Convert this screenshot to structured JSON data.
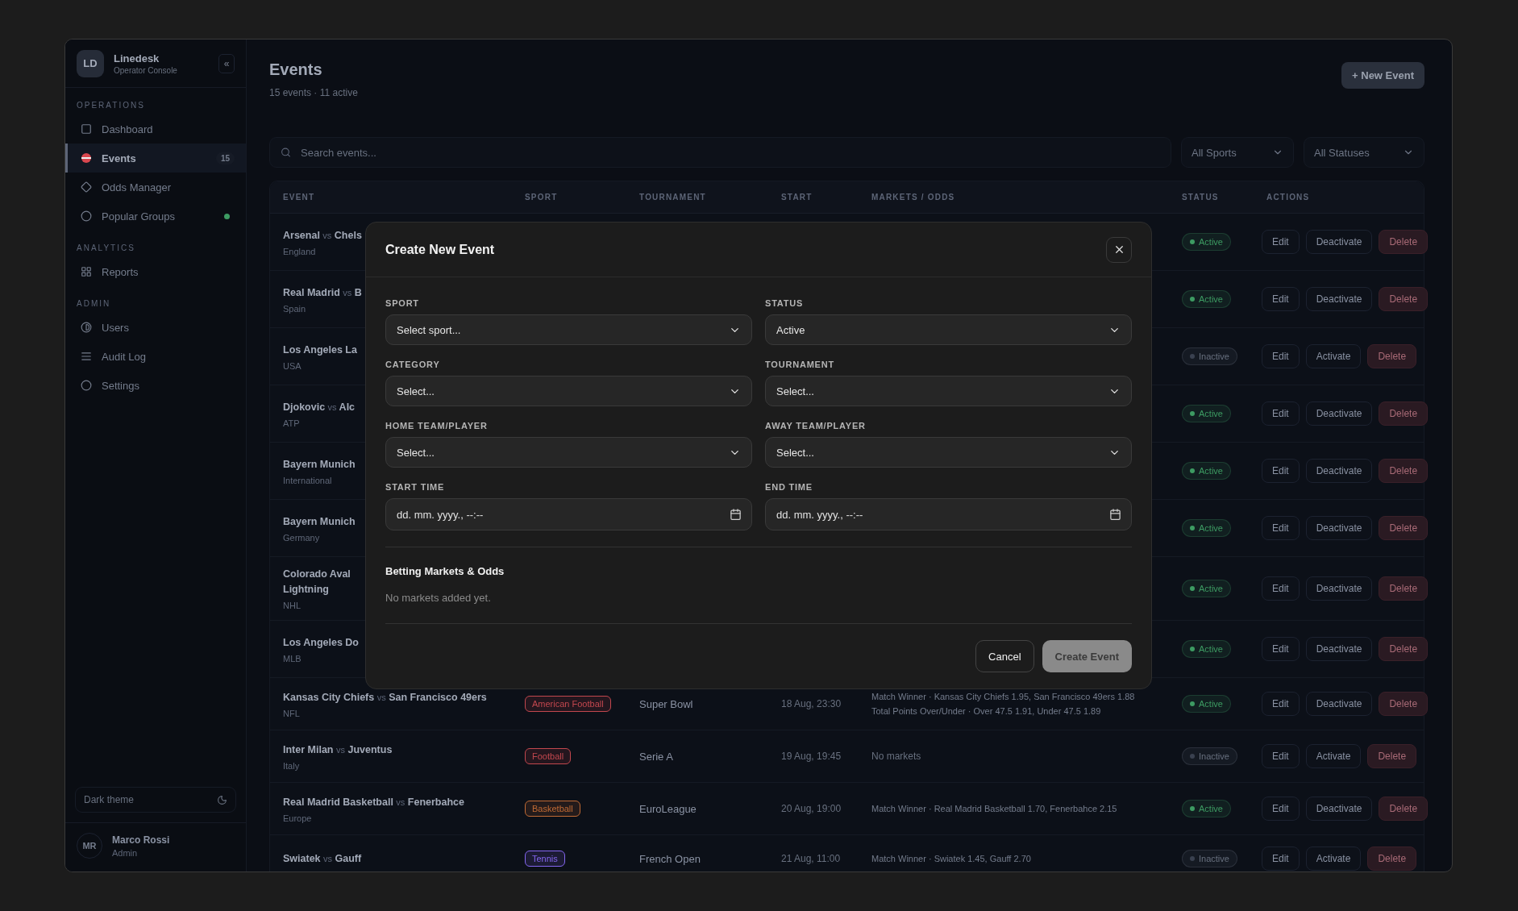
{
  "sidebar": {
    "brand": {
      "initials": "LD",
      "name": "Linedesk",
      "subtitle": "Operator Console",
      "collapse": "«"
    },
    "sections": [
      {
        "title": "OPERATIONS",
        "items": [
          {
            "label": "Dashboard",
            "selected": false,
            "dot": false
          },
          {
            "label": "Events",
            "selected": true,
            "badge": "15",
            "dot": false
          },
          {
            "label": "Odds Manager",
            "selected": false,
            "dot": false
          },
          {
            "label": "Popular Groups",
            "selected": false,
            "dot": true
          }
        ]
      },
      {
        "title": "ANALYTICS",
        "items": [
          {
            "label": "Reports",
            "selected": false,
            "dot": false
          }
        ]
      },
      {
        "title": "ADMIN",
        "items": [
          {
            "label": "Users",
            "selected": false,
            "dot": false
          },
          {
            "label": "Audit Log",
            "selected": false,
            "dot": false
          },
          {
            "label": "Settings",
            "selected": false,
            "dot": false
          }
        ]
      }
    ],
    "theme_toggle": {
      "label": "Dark theme"
    },
    "user": {
      "initials": "MR",
      "name": "Marco Rossi",
      "role": "Admin"
    }
  },
  "page": {
    "title": "Events",
    "summary": "15 events · 11 active",
    "new_button": "+ New Event"
  },
  "filters": {
    "search": {
      "placeholder": "Search events..."
    },
    "sport": "All Sports",
    "status": "All Statuses"
  },
  "table": {
    "columns": [
      "EVENT",
      "SPORT",
      "TOURNAMENT",
      "START",
      "MARKETS / ODDS",
      "STATUS",
      "ACTIONS"
    ],
    "rows": [
      {
        "home": "Arsenal",
        "vs": "vs",
        "away": "Chels",
        "region": "England",
        "status": "Active",
        "active": true,
        "actions": [
          "Edit",
          "Deactivate",
          "Delete"
        ]
      },
      {
        "home": "Real Madrid",
        "vs": "vs",
        "away": "B",
        "region": "Spain",
        "status": "Active",
        "active": true,
        "actions": [
          "Edit",
          "Deactivate",
          "Delete"
        ]
      },
      {
        "home": "Los Angeles La",
        "region": "USA",
        "status": "Inactive",
        "active": false,
        "actions": [
          "Edit",
          "Activate",
          "Delete"
        ]
      },
      {
        "home": "Djokovic",
        "vs": "vs",
        "away": "Alc",
        "region": "ATP",
        "status": "Active",
        "active": true,
        "actions": [
          "Edit",
          "Deactivate",
          "Delete"
        ]
      },
      {
        "home": "Bayern Munich",
        "region": "International",
        "status": "Active",
        "active": true,
        "actions": [
          "Edit",
          "Deactivate",
          "Delete"
        ]
      },
      {
        "home": "Bayern Munich",
        "region": "Germany",
        "status": "Active",
        "active": true,
        "actions": [
          "Edit",
          "Deactivate",
          "Delete"
        ]
      },
      {
        "home": "Colorado Aval",
        "line2": "Lightning",
        "region": "NHL",
        "status": "Active",
        "active": true,
        "actions": [
          "Edit",
          "Deactivate",
          "Delete"
        ]
      },
      {
        "home": "Los Angeles Do",
        "region": "MLB",
        "status": "Active",
        "active": true,
        "actions": [
          "Edit",
          "Deactivate",
          "Delete"
        ]
      },
      {
        "home": "Kansas City Chiefs",
        "vs": "vs",
        "away": "San Francisco 49ers",
        "region": "NFL",
        "sport": {
          "label": "American Football",
          "color": "#c2474e"
        },
        "tournament": "Super Bowl",
        "start": "18 Aug, 23:30",
        "markets": [
          "Match Winner · Kansas City Chiefs 1.95, San Francisco 49ers 1.88",
          "Total Points Over/Under · Over 47.5 1.91, Under 47.5 1.89"
        ],
        "status": "Active",
        "active": true,
        "actions": [
          "Edit",
          "Deactivate",
          "Delete"
        ]
      },
      {
        "home": "Inter Milan",
        "vs": "vs",
        "away": "Juventus",
        "region": "Italy",
        "sport": {
          "label": "Football",
          "color": "#c2474e"
        },
        "tournament": "Serie A",
        "start": "19 Aug, 19:45",
        "markets_note": "No markets",
        "status": "Inactive",
        "active": false,
        "actions": [
          "Edit",
          "Activate",
          "Delete"
        ]
      },
      {
        "home": "Real Madrid Basketball",
        "vs": "vs",
        "away": "Fenerbahce",
        "region": "Europe",
        "sport": {
          "label": "Basketball",
          "color": "#c06a34"
        },
        "tournament": "EuroLeague",
        "start": "20 Aug, 19:00",
        "markets": [
          "Match Winner · Real Madrid Basketball 1.70, Fenerbahce 2.15"
        ],
        "status": "Active",
        "active": true,
        "actions": [
          "Edit",
          "Deactivate",
          "Delete"
        ]
      },
      {
        "home": "Swiatek",
        "vs": "vs",
        "away": "Gauff",
        "sport": {
          "label": "Tennis",
          "color": "#8466f0"
        },
        "tournament": "French Open",
        "start": "21 Aug, 11:00",
        "markets": [
          "Match Winner · Swiatek 1.45, Gauff 2.70"
        ],
        "status": "Inactive",
        "active": false,
        "actions": [
          "Edit",
          "Activate",
          "Delete"
        ]
      }
    ]
  },
  "modal": {
    "title": "Create New Event",
    "fields": [
      {
        "label": "SPORT",
        "kind": "select",
        "value": "Select sport..."
      },
      {
        "label": "STATUS",
        "kind": "select",
        "value": "Active"
      },
      {
        "label": "CATEGORY",
        "kind": "select",
        "value": "Select..."
      },
      {
        "label": "TOURNAMENT",
        "kind": "select",
        "value": "Select..."
      },
      {
        "label": "HOME TEAM/PLAYER",
        "kind": "select",
        "value": "Select..."
      },
      {
        "label": "AWAY TEAM/PLAYER",
        "kind": "select",
        "value": "Select..."
      },
      {
        "label": "START TIME",
        "kind": "datetime",
        "placeholder": "dd. mm. yyyy., --:--"
      },
      {
        "label": "END TIME",
        "kind": "datetime",
        "placeholder": "dd. mm. yyyy., --:--"
      }
    ],
    "markets_title": "Betting Markets & Odds",
    "markets_empty": "No markets added yet.",
    "buttons": [
      {
        "label": "Cancel",
        "kind": "secondary",
        "disabled": false
      },
      {
        "label": "Create Event",
        "kind": "primary",
        "disabled": true
      }
    ]
  }
}
